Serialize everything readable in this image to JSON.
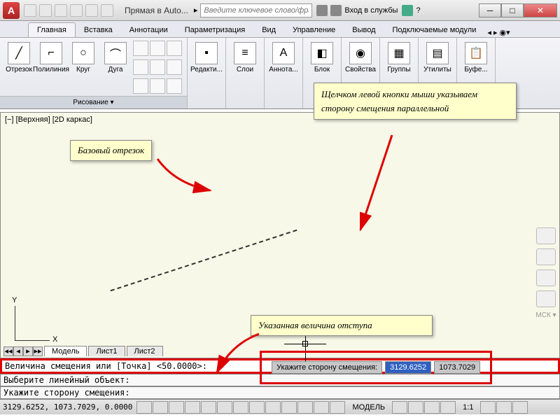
{
  "title": "Прямая в Auto...",
  "search_placeholder": "Введите ключевое слово/фразу",
  "login": "Вход в службы",
  "tabs": [
    "Главная",
    "Вставка",
    "Аннотации",
    "Параметризация",
    "Вид",
    "Управление",
    "Вывод",
    "Подключаемые модули"
  ],
  "active_tab": 0,
  "ribbon": {
    "draw_title": "Рисование ▾",
    "btns": {
      "line": "Отрезок",
      "pline": "Полилиния",
      "circle": "Круг",
      "arc": "Дуга",
      "edit": "Редакти...",
      "layers": "Слои",
      "annot": "Аннота...",
      "block": "Блок",
      "props": "Свойства",
      "groups": "Группы",
      "utils": "Утилиты",
      "buffer": "Буфе..."
    }
  },
  "viewport_label": "[−] [Верхняя] [2D каркас]",
  "ucs": {
    "x": "X",
    "y": "Y"
  },
  "dynamic_input": {
    "prompt": "Укажите сторону смещения:",
    "x": "3129.6252",
    "y": "1073.7029"
  },
  "sheet_nav": [
    "◂◂",
    "◂",
    "▸",
    "▸▸"
  ],
  "sheets": [
    "Модель",
    "Лист1",
    "Лист2"
  ],
  "callouts": {
    "c1": "Базовый отрезок",
    "c2": "Щелчком левой кнопки мыши указываем сторону смещения параллельной",
    "c3": "Указанная величина отступа"
  },
  "cmd": {
    "l1": "Величина смещения или [Точка] <50.0000>:",
    "l2": "Выберите линейный объект:",
    "l3": "Укажите сторону смещения:"
  },
  "status": {
    "coords": "3129.6252, 1073.7029, 0.0000",
    "model": "МОДЕЛЬ",
    "scale": "1:1"
  },
  "side_label": "МСК ▾"
}
